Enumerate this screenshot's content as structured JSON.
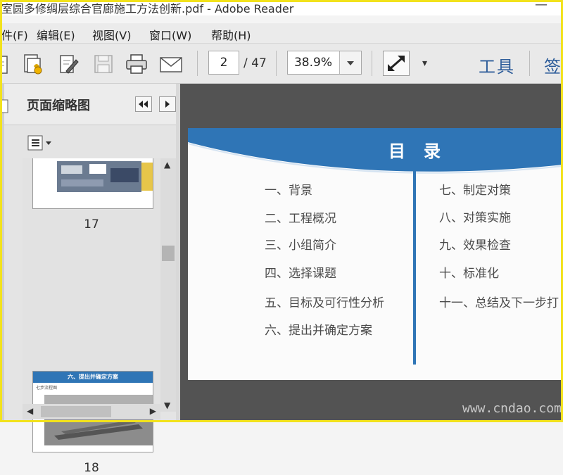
{
  "window": {
    "title": "室圆多修绸层综合官廊施工方法创新.pdf - Adobe Reader",
    "minimize_symbol": "—"
  },
  "menu": {
    "items": [
      "件(F)",
      "编辑(E)",
      "视图(V)",
      "窗口(W)",
      "帮助(H)"
    ]
  },
  "toolbar": {
    "icons": [
      "open-icon",
      "create-pdf-icon",
      "sign-edit-icon",
      "save-icon",
      "print-icon",
      "email-icon"
    ],
    "page_current": "2",
    "page_total": "/ 47",
    "zoom": "38.9%",
    "tools_label": "工具",
    "sign_label": "签"
  },
  "sidebar": {
    "title": "页面缩略图",
    "thumbnails": [
      {
        "page": "17"
      },
      {
        "page": "18",
        "header": "六、提出并确定方案",
        "sub": "七步流程图"
      }
    ]
  },
  "document": {
    "toc_title": "目录",
    "left_items": [
      "一、背景",
      "二、工程概况",
      "三、小组简介",
      "四、选择课题",
      "五、目标及可行性分析",
      "六、提出并确定方案"
    ],
    "right_items": [
      "七、制定对策",
      "八、对策实施",
      "九、效果检查",
      "十、标准化",
      "十一、总结及下一步打"
    ],
    "accent_color": "#2f75b6"
  },
  "watermark": "www.cndao.com"
}
